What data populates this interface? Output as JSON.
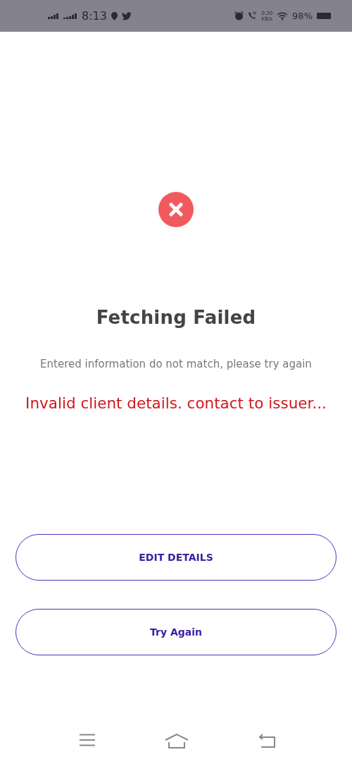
{
  "status_bar": {
    "time": "8:13",
    "speed_value": "0.20",
    "speed_unit": "KB/s",
    "battery": "98%"
  },
  "result": {
    "title": "Fetching Failed",
    "message": "Entered information do not match, please try again",
    "error": "Invalid client details. contact to issuer..."
  },
  "buttons": [
    {
      "label": "EDIT DETAILS"
    },
    {
      "label": "Try Again"
    }
  ]
}
